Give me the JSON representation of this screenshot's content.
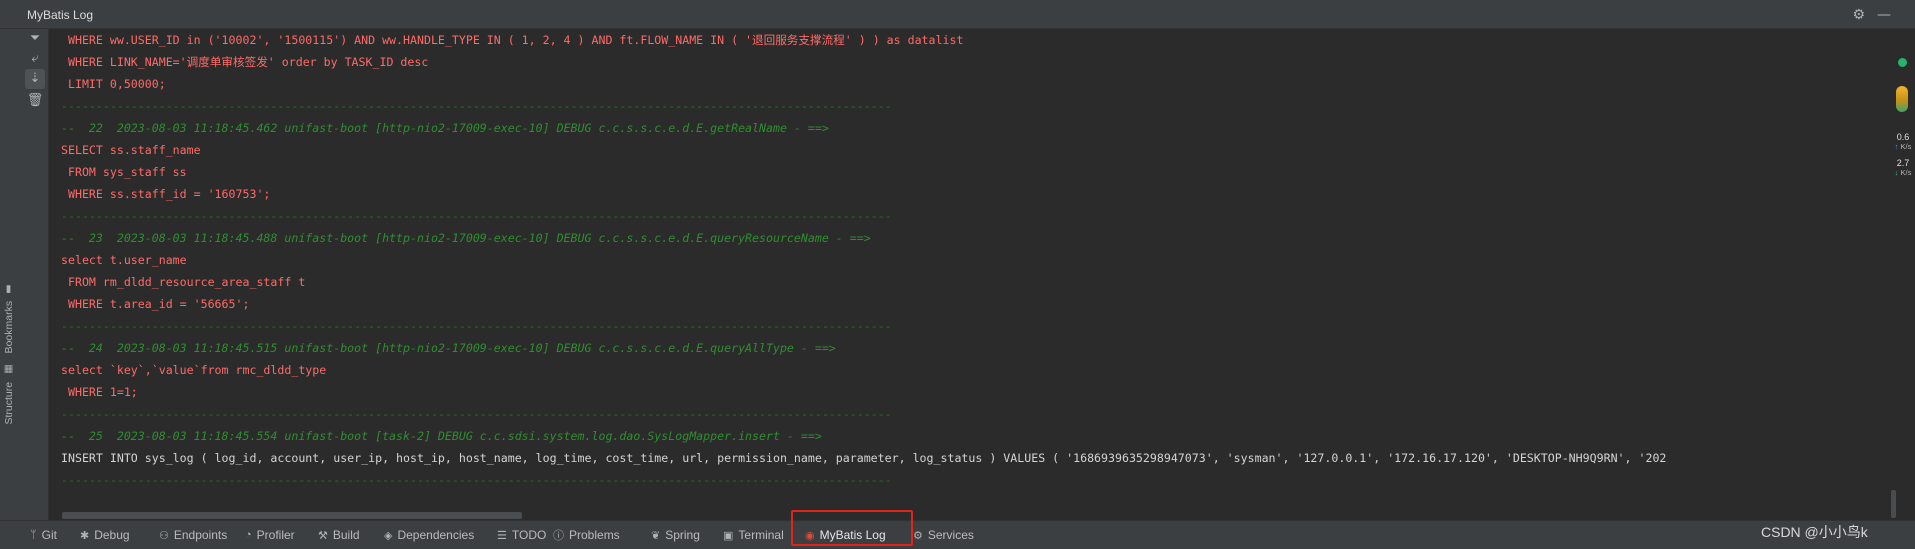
{
  "window": {
    "title": "MyBatis Log"
  },
  "left_strip": {
    "bookmarks_label": "Bookmarks",
    "structure_label": "Structure"
  },
  "toolbar": {
    "filter_icon": "filter-icon",
    "wrap_icon": "soft-wrap-icon",
    "scroll_icon": "scroll-to-end-icon",
    "clear_icon": "trash-icon"
  },
  "log": {
    "lines": [
      {
        "kind": "red",
        "text": " WHERE ww.USER_ID in ('10002', '1500115') AND ww.HANDLE_TYPE IN ( 1, 2, 4 ) AND ft.FLOW_NAME IN ( '退回服务支撑流程' ) ) as datalist"
      },
      {
        "kind": "red",
        "text": " WHERE LINK_NAME='调度单审核签发' order by TASK_ID desc"
      },
      {
        "kind": "red",
        "text": " LIMIT 0,50000;"
      },
      {
        "kind": "sep",
        "text": "-----------------------------------------------------------------------------------------------------------------------"
      },
      {
        "kind": "green",
        "text": "--  22  2023-08-03 11:18:45.462 unifast-boot [http-nio2-17009-exec-10] DEBUG c.c.s.s.c.e.d.E.getRealName - ==>"
      },
      {
        "kind": "red",
        "text": "SELECT ss.staff_name"
      },
      {
        "kind": "red",
        "text": " FROM sys_staff ss"
      },
      {
        "kind": "red",
        "text": " WHERE ss.staff_id = '160753';"
      },
      {
        "kind": "sep",
        "text": "-----------------------------------------------------------------------------------------------------------------------"
      },
      {
        "kind": "green",
        "text": "--  23  2023-08-03 11:18:45.488 unifast-boot [http-nio2-17009-exec-10] DEBUG c.c.s.s.c.e.d.E.queryResourceName - ==>"
      },
      {
        "kind": "red",
        "text": "select t.user_name"
      },
      {
        "kind": "red",
        "text": " FROM rm_dldd_resource_area_staff t"
      },
      {
        "kind": "red",
        "text": " WHERE t.area_id = '56665';"
      },
      {
        "kind": "sep",
        "text": "-----------------------------------------------------------------------------------------------------------------------"
      },
      {
        "kind": "green",
        "text": "--  24  2023-08-03 11:18:45.515 unifast-boot [http-nio2-17009-exec-10] DEBUG c.c.s.s.c.e.d.E.queryAllType - ==>"
      },
      {
        "kind": "red",
        "text": "select `key`,`value`from rmc_dldd_type"
      },
      {
        "kind": "red",
        "text": " WHERE 1=1;"
      },
      {
        "kind": "sep",
        "text": "-----------------------------------------------------------------------------------------------------------------------"
      },
      {
        "kind": "green",
        "text": "--  25  2023-08-03 11:18:45.554 unifast-boot [task-2] DEBUG c.c.sdsi.system.log.dao.SysLogMapper.insert - ==>"
      },
      {
        "kind": "white",
        "text": "INSERT INTO sys_log ( log_id, account, user_ip, host_ip, host_name, log_time, cost_time, url, permission_name, parameter, log_status ) VALUES ( '1686939635298947073', 'sysman', '127.0.0.1', '172.16.17.120', 'DESKTOP-NH9Q9RN', '202"
      },
      {
        "kind": "sep",
        "text": "-----------------------------------------------------------------------------------------------------------------------"
      }
    ]
  },
  "net_widget": {
    "up_value": "0.6",
    "up_unit": "K/s",
    "down_value": "2.7",
    "down_unit": "K/s"
  },
  "bottom_tabs": [
    {
      "label": "Git",
      "icon": "git-branch-icon",
      "glyph": "ᛘ"
    },
    {
      "label": "Debug",
      "icon": "bug-icon",
      "glyph": "✱"
    },
    {
      "label": "Endpoints",
      "icon": "endpoints-icon",
      "glyph": "⚇"
    },
    {
      "label": "Profiler",
      "icon": "profiler-icon",
      "glyph": "◔"
    },
    {
      "label": "Build",
      "icon": "hammer-icon",
      "glyph": "⚒"
    },
    {
      "label": "Dependencies",
      "icon": "dependencies-icon",
      "glyph": "◈"
    },
    {
      "label": "TODO",
      "icon": "list-icon",
      "glyph": "☰"
    },
    {
      "label": "Problems",
      "icon": "info-icon",
      "glyph": "ⓘ"
    },
    {
      "label": "Spring",
      "icon": "spring-leaf-icon",
      "glyph": "❦"
    },
    {
      "label": "Terminal",
      "icon": "terminal-icon",
      "glyph": "▣"
    },
    {
      "label": "MyBatis Log",
      "icon": "mybatis-bird-icon",
      "glyph": "◉"
    },
    {
      "label": "Services",
      "icon": "services-icon",
      "glyph": "⚙"
    }
  ],
  "watermark": "CSDN @小小鸟k"
}
